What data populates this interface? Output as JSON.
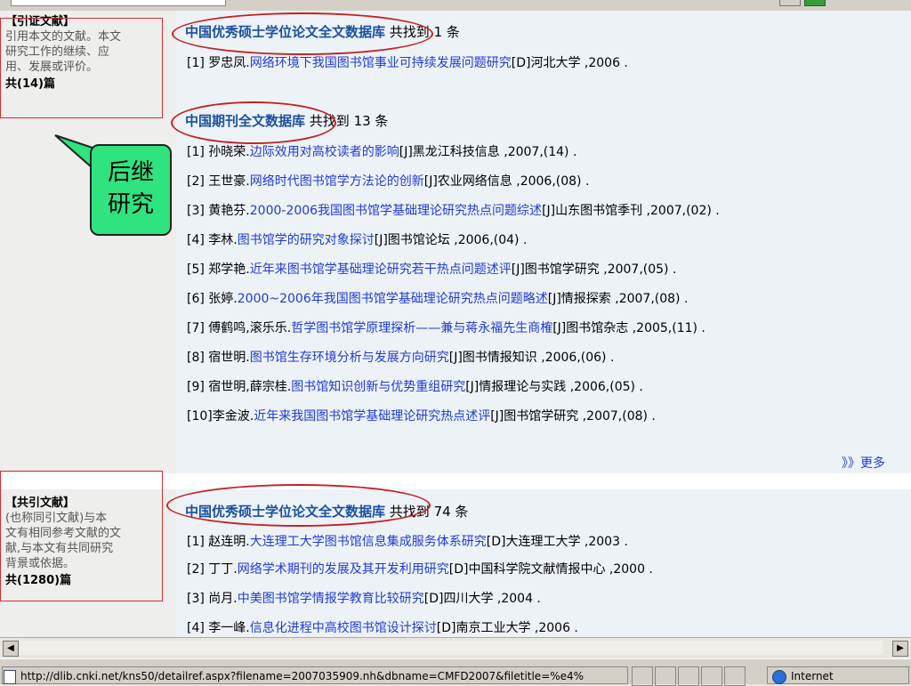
{
  "citing": {
    "sidebar": {
      "title": "【引证文献】",
      "desc": [
        "引用本文的文献。本文",
        "研究工作的继续、应",
        "用、发展或评价。"
      ],
      "count": "共(14)篇"
    },
    "sections": [
      {
        "db": "中国优秀硕士学位论文全文数据库",
        "found": "共找到 1 条",
        "rows": [
          {
            "idx": "[1]",
            "author": "罗忠凤.",
            "title": "网络环境下我国图书馆事业可持续发展问题研究",
            "source": "[D]河北大学 ,2006 ."
          }
        ]
      },
      {
        "db": "中国期刊全文数据库",
        "found": "共找到 13 条",
        "rows": [
          {
            "idx": "[1]",
            "author": "孙晓荣.",
            "title": "边际效用对高校读者的影响",
            "source": "[J]黑龙江科技信息 ,2007,(14) ."
          },
          {
            "idx": "[2]",
            "author": "王世豪.",
            "title": "网络时代图书馆学方法论的创新",
            "source": "[J]农业网络信息 ,2006,(08) ."
          },
          {
            "idx": "[3]",
            "author": "黄艳芬.",
            "title": "2000-2006我国图书馆学基础理论研究热点问题综述",
            "source": "[J]山东图书馆季刊 ,2007,(02) ."
          },
          {
            "idx": "[4]",
            "author": "李林.",
            "title": "图书馆学的研究对象探讨",
            "source": "[J]图书馆论坛 ,2006,(04) ."
          },
          {
            "idx": "[5]",
            "author": "郑学艳.",
            "title": "近年来图书馆学基础理论研究若干热点问题述评",
            "source": "[J]图书馆学研究 ,2007,(05) ."
          },
          {
            "idx": "[6]",
            "author": "张婷.",
            "title": "2000~2006年我国图书馆学基础理论研究热点问题略述",
            "source": "[J]情报探索 ,2007,(08) ."
          },
          {
            "idx": "[7]",
            "author": "傅鹤鸣,滚乐乐.",
            "title": "哲学图书馆学原理探析——兼与蒋永福先生商榷",
            "source": "[J]图书馆杂志 ,2005,(11) ."
          },
          {
            "idx": "[8]",
            "author": "宿世明.",
            "title": "图书馆生存环境分析与发展方向研究",
            "source": "[J]图书情报知识 ,2006,(06) ."
          },
          {
            "idx": "[9]",
            "author": "宿世明,薛宗桂.",
            "title": "图书馆知识创新与优势重组研究",
            "source": "[J]情报理论与实践 ,2006,(05) ."
          },
          {
            "idx": "[10]",
            "author": "李金波.",
            "title": "近年来我国图书馆学基础理论研究热点述评",
            "source": "[J]图书馆学研究 ,2007,(08) ."
          }
        ]
      }
    ],
    "more": "》》更多"
  },
  "cocited": {
    "sidebar": {
      "title": "【共引文献】",
      "desc": [
        "(也称同引文献)与本",
        "文有相同参考文献的文",
        "献,与本文有共同研究",
        "背景或依据。"
      ],
      "count": "共(1280)篇"
    },
    "section": {
      "db": "中国优秀硕士学位论文全文数据库",
      "found": "共找到 74 条",
      "rows": [
        {
          "idx": "[1]",
          "author": "赵连明.",
          "title": "大连理工大学图书馆信息集成服务体系研究",
          "source": "[D]大连理工大学 ,2003 ."
        },
        {
          "idx": "[2]",
          "author": "丁丁.",
          "title": "网络学术期刊的发展及其开发利用研究",
          "source": "[D]中国科学院文献情报中心 ,2000 ."
        },
        {
          "idx": "[3]",
          "author": "尚月.",
          "title": "中美图书馆学情报学教育比较研究",
          "source": "[D]四川大学 ,2004 ."
        },
        {
          "idx": "[4]",
          "author": "李一峰.",
          "title": "信息化进程中高校图书馆设计探讨",
          "source": "[D]南京工业大学 ,2006 ."
        }
      ]
    }
  },
  "callout": {
    "line1": "后继",
    "line2": "研究",
    "color": "#2fe37e"
  },
  "scrollbar": {
    "left_icon": "triangle-left-icon",
    "right_icon": "triangle-right-icon"
  },
  "statusbar": {
    "url": "http://dlib.cnki.net/kns50/detailref.aspx?filename=2007035909.nh&dbname=CMFD2007&filetitle=%e4%",
    "zone": "Internet"
  },
  "colors": {
    "link": "#1f3bd6",
    "db_title": "#1a4fa0",
    "annotation": "#c42222"
  }
}
